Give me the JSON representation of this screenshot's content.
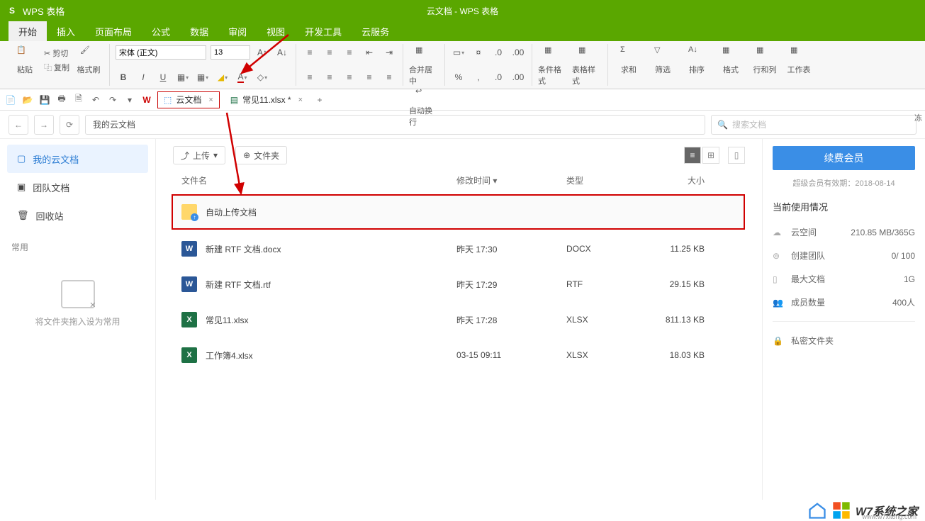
{
  "titlebar": {
    "app_name": "WPS 表格",
    "doc_title": "云文档 - WPS 表格"
  },
  "menubar": {
    "items": [
      "开始",
      "插入",
      "页面布局",
      "公式",
      "数据",
      "审阅",
      "视图",
      "开发工具",
      "云服务"
    ],
    "active_index": 0
  },
  "ribbon": {
    "paste": "粘贴",
    "cut": "剪切",
    "copy": "复制",
    "format_painter": "格式刷",
    "font_name": "宋体 (正文)",
    "font_size": "13",
    "merge_center": "合并居中",
    "wrap_text": "自动换行",
    "cond_format": "条件格式",
    "table_style": "表格样式",
    "sum": "求和",
    "filter": "筛选",
    "sort": "排序",
    "format": "格式",
    "rows_cols": "行和列",
    "worksheet": "工作表",
    "freeze_trunc": "冻"
  },
  "tabs": {
    "cloud_tab": "云文档",
    "file_tab": "常见11.xlsx *"
  },
  "nav": {
    "breadcrumb": "我的云文档",
    "search_placeholder": "搜索文档"
  },
  "sidebar": {
    "items": [
      {
        "label": "我的云文档",
        "icon": "folder"
      },
      {
        "label": "团队文档",
        "icon": "team"
      },
      {
        "label": "回收站",
        "icon": "trash"
      }
    ],
    "common_label": "常用",
    "dropzone_text": "将文件夹拖入设为常用"
  },
  "toolbar2": {
    "upload": "上传",
    "new_folder": "文件夹"
  },
  "columns": {
    "name": "文件名",
    "time": "修改时间",
    "type": "类型",
    "size": "大小"
  },
  "files": [
    {
      "name": "自动上传文档",
      "time": "",
      "type": "",
      "size": "",
      "icon": "folder",
      "highlight": true
    },
    {
      "name": "新建 RTF 文档.docx",
      "time": "昨天 17:30",
      "type": "DOCX",
      "size": "11.25 KB",
      "icon": "docx"
    },
    {
      "name": "新建 RTF 文档.rtf",
      "time": "昨天 17:29",
      "type": "RTF",
      "size": "29.15 KB",
      "icon": "rtf"
    },
    {
      "name": "常见11.xlsx",
      "time": "昨天 17:28",
      "type": "XLSX",
      "size": "811.13 KB",
      "icon": "xlsx"
    },
    {
      "name": "工作簿4.xlsx",
      "time": "03-15 09:11",
      "type": "XLSX",
      "size": "18.03 KB",
      "icon": "xlsx"
    }
  ],
  "rightpane": {
    "member_btn": "续费会员",
    "expiry": "超级会员有效期：2018-08-14",
    "usage_title": "当前使用情况",
    "rows": [
      {
        "icon": "cloud",
        "label": "云空间",
        "value": "210.85 MB/365G"
      },
      {
        "icon": "team",
        "label": "创建团队",
        "value": "0/ 100"
      },
      {
        "icon": "doc",
        "label": "最大文档",
        "value": "1G"
      },
      {
        "icon": "members",
        "label": "成员数量",
        "value": "400人"
      }
    ],
    "private_folder": "私密文件夹"
  },
  "watermark": {
    "text": "W7系统之家",
    "sub": "www.w7xitong.com"
  }
}
